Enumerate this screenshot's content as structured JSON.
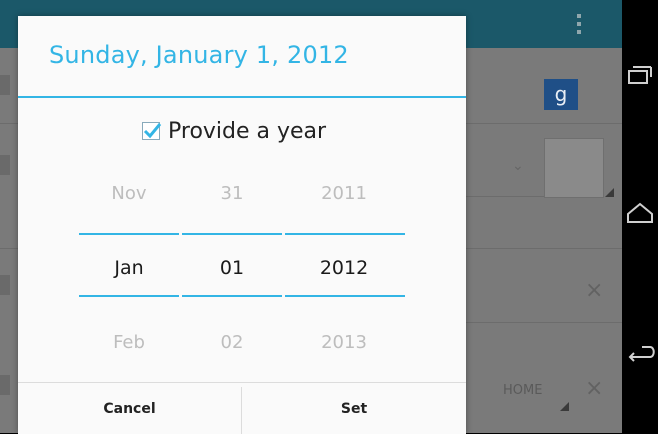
{
  "dialog": {
    "title": "Sunday, January 1, 2012",
    "year_checkbox": {
      "label": "Provide a year",
      "checked": true
    },
    "pickers": {
      "month": {
        "prev": "Nov",
        "current": "Jan",
        "next": "Feb"
      },
      "day": {
        "prev": "31",
        "current": "01",
        "next": "02"
      },
      "year": {
        "prev": "2011",
        "current": "2012",
        "next": "2013"
      }
    },
    "buttons": {
      "cancel": "Cancel",
      "set": "Set"
    }
  },
  "background_app": {
    "badge_letter": "g",
    "home_label": "HOME",
    "clear_symbol": "×"
  },
  "navigation_bar": {
    "icons": [
      "recent-apps-icon",
      "home-icon",
      "back-icon"
    ]
  },
  "colors": {
    "accent": "#33b5e5",
    "dim_overlay": "#7a7a7a",
    "action_bar": "#1b5869"
  }
}
